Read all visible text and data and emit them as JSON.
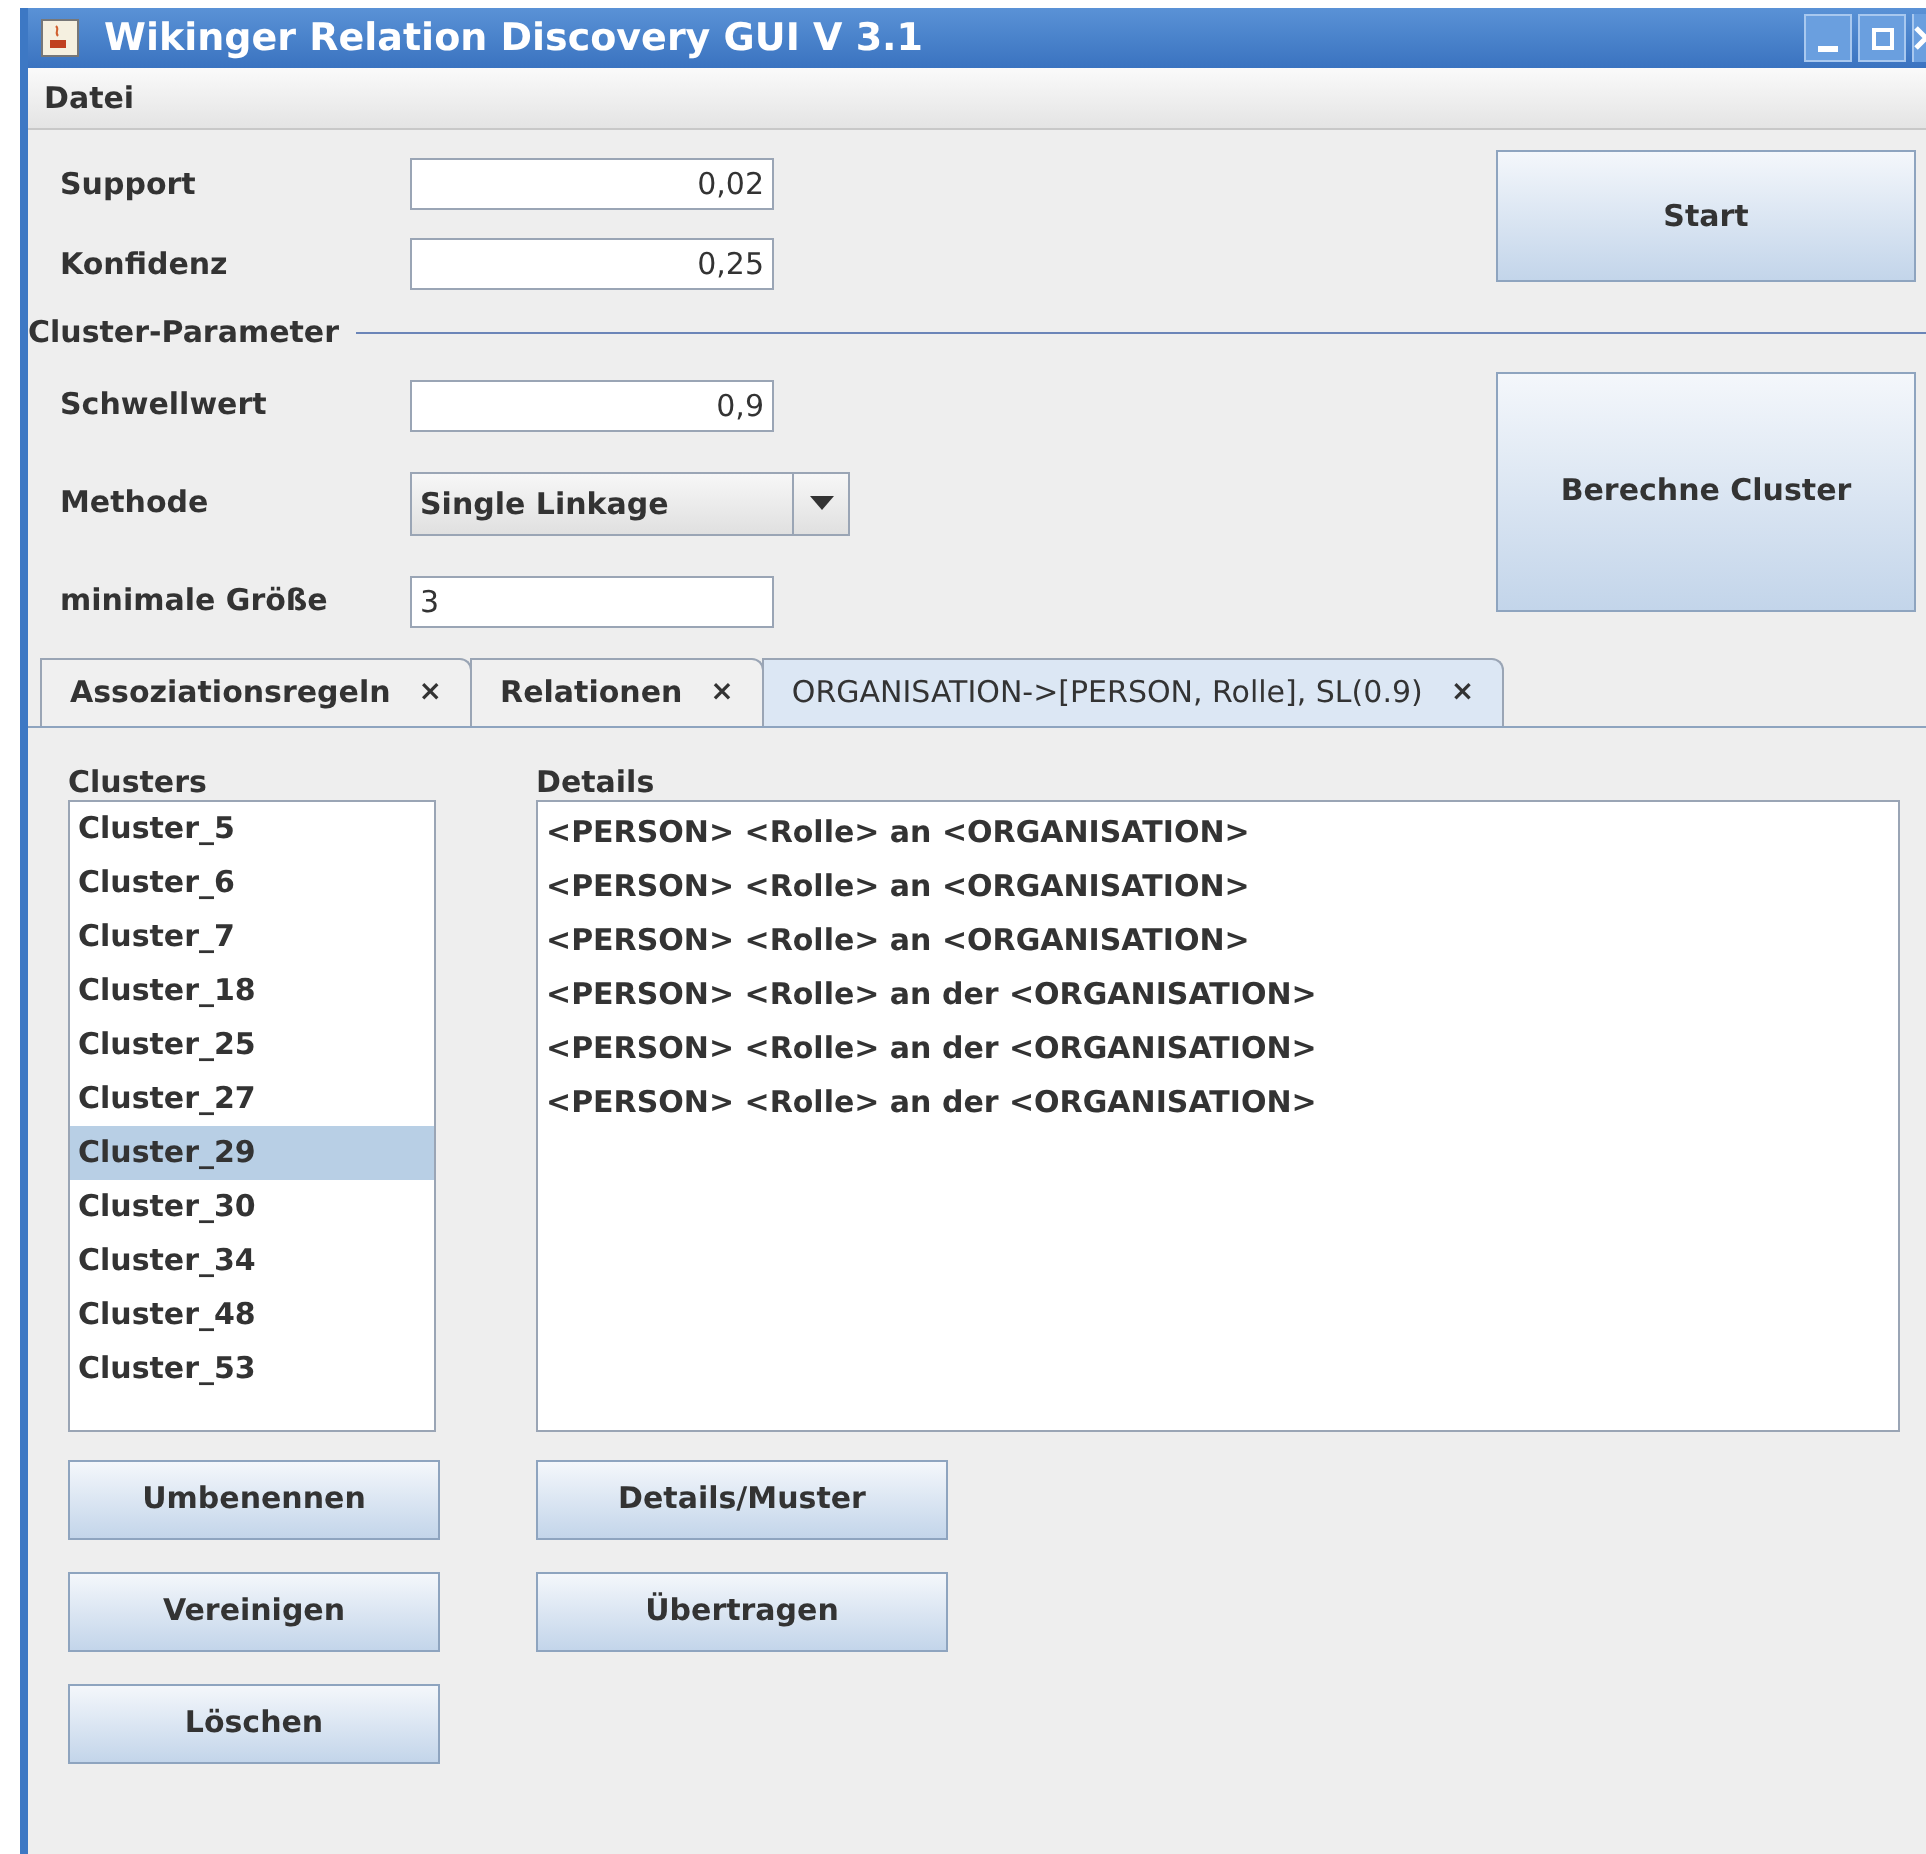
{
  "window": {
    "title": "Wikinger Relation Discovery GUI V 3.1"
  },
  "menu": [
    "Datei"
  ],
  "parameters": [
    {
      "label": "Support",
      "value": "0,02"
    },
    {
      "label": "Konfidenz",
      "value": "0,25"
    }
  ],
  "start_button": "Start",
  "cluster_section": {
    "title": "Cluster-Parameter",
    "threshold": {
      "label": "Schwellwert",
      "value": "0,9"
    },
    "method": {
      "label": "Methode",
      "value": "Single Linkage"
    },
    "min_size": {
      "label": "minimale Größe",
      "value": "3"
    },
    "button": "Berechne Cluster"
  },
  "tabs": [
    {
      "label": "Assoziationsregeln",
      "close": "×",
      "selected": false
    },
    {
      "label": "Relationen",
      "close": "×",
      "selected": false
    },
    {
      "label": "ORGANISATION->[PERSON, Rolle], SL(0.9)",
      "close": "×",
      "selected": true
    }
  ],
  "clusters": {
    "title": "Clusters",
    "items": [
      {
        "label": "Cluster_5",
        "selected": false
      },
      {
        "label": "Cluster_6",
        "selected": false
      },
      {
        "label": "Cluster_7",
        "selected": false
      },
      {
        "label": "Cluster_18",
        "selected": false
      },
      {
        "label": "Cluster_25",
        "selected": false
      },
      {
        "label": "Cluster_27",
        "selected": false
      },
      {
        "label": "Cluster_29",
        "selected": true
      },
      {
        "label": "Cluster_30",
        "selected": false
      },
      {
        "label": "Cluster_34",
        "selected": false
      },
      {
        "label": "Cluster_48",
        "selected": false
      },
      {
        "label": "Cluster_53",
        "selected": false
      }
    ],
    "buttons": [
      "Umbenennen",
      "Vereinigen",
      "Löschen"
    ]
  },
  "details": {
    "title": "Details",
    "lines": [
      "<PERSON> <Rolle> an <ORGANISATION>",
      "<PERSON> <Rolle> an <ORGANISATION>",
      "<PERSON> <Rolle> an <ORGANISATION>",
      "<PERSON> <Rolle> an der <ORGANISATION>",
      "<PERSON> <Rolle> an der <ORGANISATION>",
      "<PERSON> <Rolle> an der <ORGANISATION>"
    ],
    "buttons": [
      "Details/Muster",
      "Übertragen"
    ]
  }
}
